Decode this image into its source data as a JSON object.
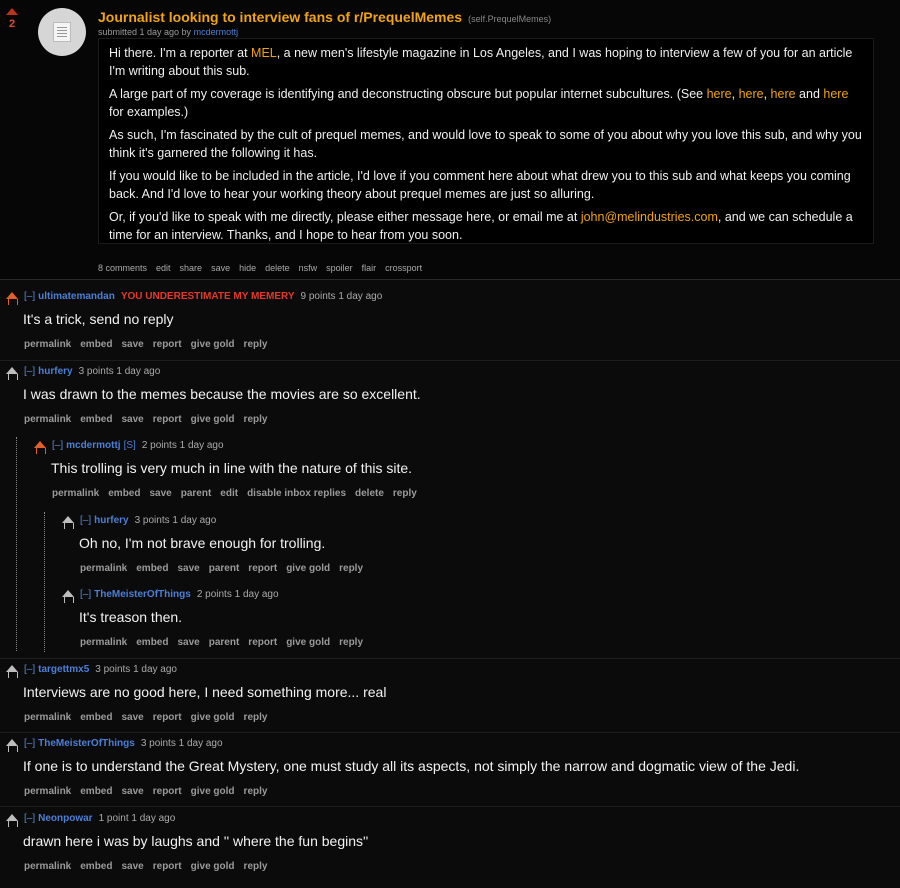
{
  "post": {
    "score": "2",
    "title": "Journalist looking to interview fans of r/PrequelMemes",
    "domain": "(self.PrequelMemes)",
    "tagline_prefix": "submitted 1 day ago by",
    "author": "mcdermottj",
    "paragraphs": [
      [
        "Hi there. I'm a reporter at ",
        {
          "link": "MEL"
        },
        ", a new men's lifestyle magazine in Los Angeles, and I was hoping to interview a few of you for an article I'm writing about this sub."
      ],
      [
        "A large part of my coverage is identifying and deconstructing obscure but popular internet subcultures. (See ",
        {
          "link": "here"
        },
        ", ",
        {
          "link": "here"
        },
        ", ",
        {
          "link": "here"
        },
        " and ",
        {
          "link": "here"
        },
        " for examples.)"
      ],
      [
        "As such, I'm fascinated by the cult of prequel memes, and would love to speak to some of you about why you love this sub, and why you think it's garnered the following it has."
      ],
      [
        "If you would like to be included in the article, I'd love if you comment here about what drew you to this sub and what keeps you coming back. And I'd love to hear your working theory about prequel memes are just so alluring."
      ],
      [
        "Or, if you'd like to speak with me directly, please either message here, or email me at ",
        {
          "link": "john@melindustries.com"
        },
        ", and we can schedule a time for an interview. Thanks, and I hope to hear from you soon."
      ]
    ],
    "buttons": [
      "8 comments",
      "edit",
      "share",
      "save",
      "hide",
      "delete",
      "nsfw",
      "spoiler",
      "flair",
      "crossport"
    ]
  },
  "comments": [
    {
      "author": "ultimatemandan",
      "flair": "YOU UNDERESTIMATE MY MEMERY",
      "meta": "9 points 1 day ago",
      "body": "It's a trick, send no reply",
      "buttons": [
        "permalink",
        "embed",
        "save",
        "report",
        "give gold",
        "reply"
      ]
    },
    {
      "author": "hurfery",
      "meta": "3 points 1 day ago",
      "body": "I was drawn to the memes because the movies are so excellent.",
      "buttons": [
        "permalink",
        "embed",
        "save",
        "report",
        "give gold",
        "reply"
      ]
    },
    {
      "author": "mcdermottj",
      "submitter": "[S]",
      "meta": "2 points 1 day ago",
      "body": "This trolling is very much in line with the nature of this site.",
      "buttons": [
        "permalink",
        "embed",
        "save",
        "parent",
        "edit",
        "disable inbox replies",
        "delete",
        "reply"
      ]
    },
    {
      "author": "hurfery",
      "meta": "3 points 1 day ago",
      "body": "Oh no, I'm not brave enough for trolling.",
      "buttons": [
        "permalink",
        "embed",
        "save",
        "parent",
        "report",
        "give gold",
        "reply"
      ]
    },
    {
      "author": "TheMeisterOfThings",
      "meta": "2 points 1 day ago",
      "body": "It's treason then.",
      "buttons": [
        "permalink",
        "embed",
        "save",
        "parent",
        "report",
        "give gold",
        "reply"
      ]
    },
    {
      "author": "targettmx5",
      "meta": "3 points 1 day ago",
      "body": "Interviews are no good here, I need something more... real",
      "buttons": [
        "permalink",
        "embed",
        "save",
        "report",
        "give gold",
        "reply"
      ]
    },
    {
      "author": "TheMeisterOfThings",
      "meta": "3 points 1 day ago",
      "body": "If one is to understand the Great Mystery, one must study all its aspects, not simply the narrow and dogmatic view of the Jedi.",
      "buttons": [
        "permalink",
        "embed",
        "save",
        "report",
        "give gold",
        "reply"
      ]
    },
    {
      "author": "Neonpowar",
      "meta": "1 point 1 day ago",
      "body": "drawn here i was by laughs and '' where the fun begins''",
      "buttons": [
        "permalink",
        "embed",
        "save",
        "report",
        "give gold",
        "reply"
      ]
    }
  ],
  "toggle_label": "[–]"
}
